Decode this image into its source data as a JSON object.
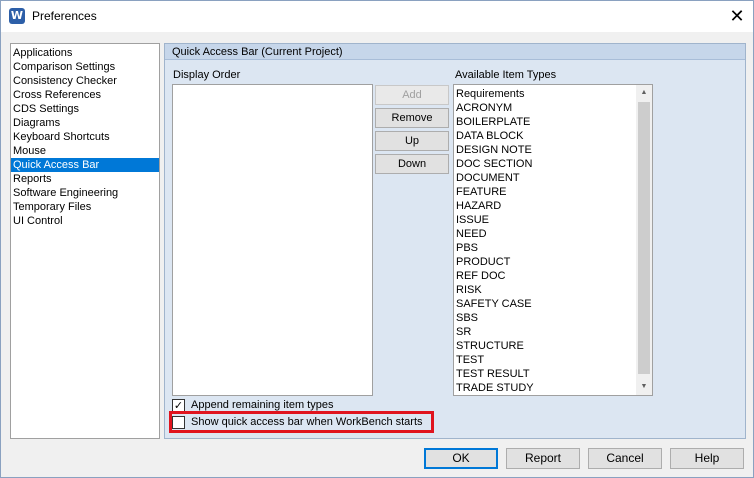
{
  "window": {
    "title": "Preferences",
    "app_icon_letter": "W",
    "close_glyph": "✕"
  },
  "categories": [
    {
      "label": "Applications",
      "selected": false
    },
    {
      "label": "Comparison Settings",
      "selected": false
    },
    {
      "label": "Consistency Checker",
      "selected": false
    },
    {
      "label": "Cross References",
      "selected": false
    },
    {
      "label": "CDS Settings",
      "selected": false
    },
    {
      "label": "Diagrams",
      "selected": false
    },
    {
      "label": "Keyboard Shortcuts",
      "selected": false
    },
    {
      "label": "Mouse",
      "selected": false
    },
    {
      "label": "Quick Access Bar",
      "selected": true
    },
    {
      "label": "Reports",
      "selected": false
    },
    {
      "label": "Software Engineering",
      "selected": false
    },
    {
      "label": "Temporary Files",
      "selected": false
    },
    {
      "label": "UI Control",
      "selected": false
    }
  ],
  "panel": {
    "header": "Quick Access Bar (Current Project)",
    "display_order_label": "Display Order",
    "available_label": "Available Item Types",
    "buttons": {
      "add": "Add",
      "remove": "Remove",
      "up": "Up",
      "down": "Down"
    },
    "available_items": [
      "Requirements",
      "ACRONYM",
      "BOILERPLATE",
      "DATA BLOCK",
      "DESIGN NOTE",
      "DOC SECTION",
      "DOCUMENT",
      "FEATURE",
      "HAZARD",
      "ISSUE",
      "NEED",
      "PBS",
      "PRODUCT",
      "REF DOC",
      "RISK",
      "SAFETY CASE",
      "SBS",
      "SR",
      "STRUCTURE",
      "TEST",
      "TEST RESULT",
      "TRADE STUDY"
    ],
    "append_remaining": {
      "label": "Append remaining item types",
      "checked": true
    },
    "show_on_start": {
      "label": "Show quick access bar when WorkBench starts",
      "checked": false
    },
    "scroll_up": "▲",
    "scroll_down": "▼",
    "check_glyph": "✓"
  },
  "footer": {
    "ok": "OK",
    "report": "Report",
    "cancel": "Cancel",
    "help": "Help"
  },
  "colors": {
    "selection": "#0078d7",
    "highlight_border": "#e0141e",
    "panel_bg": "#dce6f2"
  }
}
